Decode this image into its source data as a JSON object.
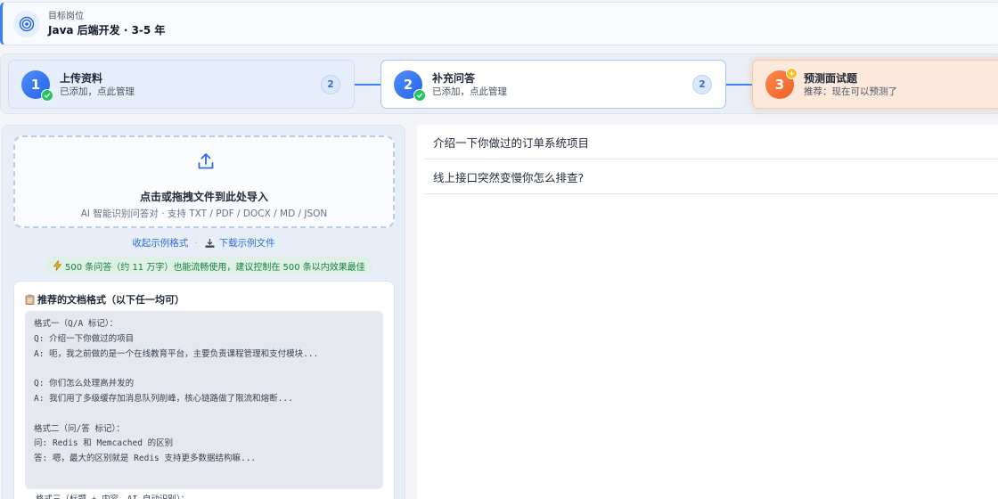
{
  "header": {
    "label": "目标岗位",
    "title": "Java 后端开发 · 3-5 年",
    "icon": "target-icon"
  },
  "steps": [
    {
      "number": "1",
      "title": "上传资料",
      "subtitle": "已添加，点此管理",
      "count": "2",
      "status": "done"
    },
    {
      "number": "2",
      "title": "补充问答",
      "subtitle": "已添加，点此管理",
      "count": "2",
      "status": "done"
    },
    {
      "number": "3",
      "title": "预测面试题",
      "subtitle": "推荐：现在可以预测了",
      "status": "active"
    }
  ],
  "upload": {
    "title": "点击或拖拽文件到此处导入",
    "subtitle": "AI 智能识别问答对 · 支持 TXT / PDF / DOCX / MD / JSON",
    "collapse_link": "收起示例格式",
    "separator": "·",
    "download_link": "下载示例文件",
    "tip": "500 条问答（约 11 万字）也能流畅使用，建议控制在 500 条以内效果最佳"
  },
  "format_card": {
    "title": "推荐的文档格式（以下任一均可）",
    "lines": [
      "格式一（Q/A 标记）：",
      "Q: 介绍一下你做过的项目",
      "A: 呃，我之前做的是一个在线教育平台，主要负责课程管理和支付模块...",
      "",
      "Q: 你们怎么处理高并发的",
      "A: 我们用了多级缓存加消息队列削峰，核心链路做了限流和熔断...",
      "",
      "格式二（问/答 标记）：",
      "问: Redis 和 Memcached 的区别",
      "答: 嗯，最大的区别就是 Redis 支持更多数据结构嘛..."
    ],
    "line_after": "格式三（标题 + 内容，AI 自动识别）："
  },
  "questions": [
    "介绍一下你做过的订单系统项目",
    "线上接口突然变慢你怎么排查?"
  ],
  "colors": {
    "accent": "#3b82f6",
    "success": "#22c55e",
    "orange": "#f05f24"
  }
}
